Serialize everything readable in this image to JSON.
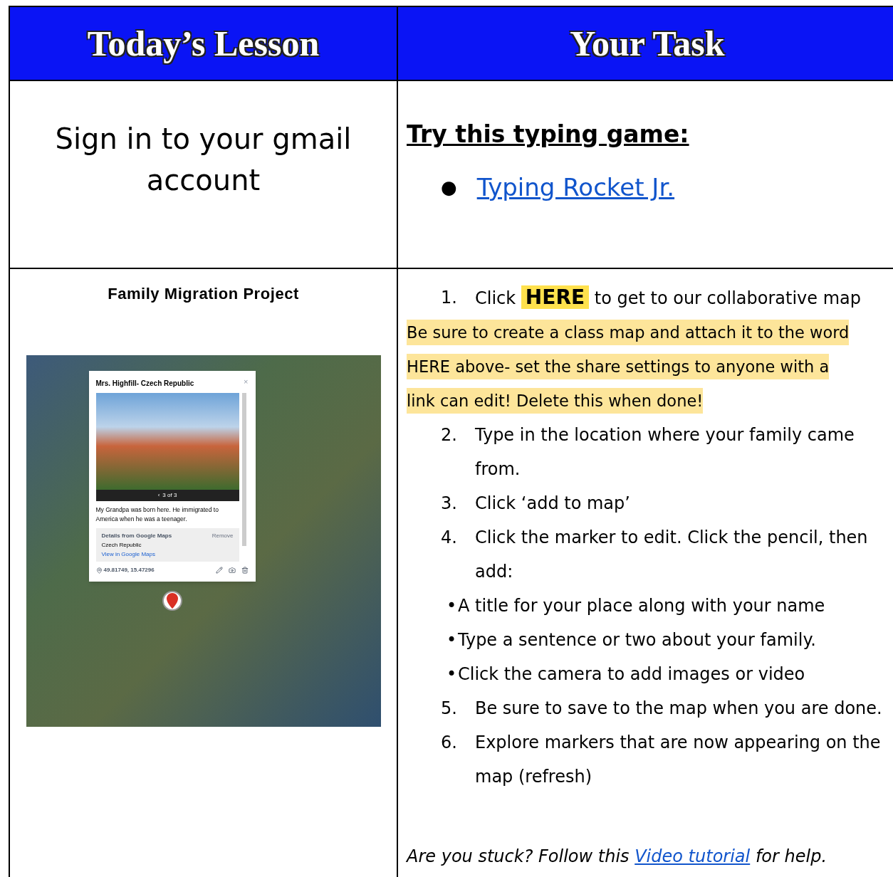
{
  "header": {
    "left": "Today’s Lesson",
    "right": "Your Task"
  },
  "lesson": {
    "text": "Sign in to your gmail account"
  },
  "task": {
    "heading": "Try this typing game:",
    "bullet": "●",
    "link": "Typing Rocket Jr."
  },
  "project": {
    "title": "Family Migration Project",
    "map_popup": {
      "title": "Mrs. Highfill- Czech Republic",
      "close": "×",
      "photo_counter": "3 of 3",
      "photo_prev": "‹",
      "description": "My Grandpa was born here. He immigrated to America when he was a teenager.",
      "details_title": "Details from Google Maps",
      "remove": "Remove",
      "place": "Czech Republic",
      "maps_link": "View in Google Maps",
      "coordinates": "49.81749, 15.47296"
    }
  },
  "steps": [
    {
      "kind": "numbered",
      "number": "1.",
      "text": "Click",
      "link": "HERE",
      "after": "to get to our collaborative map"
    },
    {
      "kind": "note",
      "lines": [
        "Be sure to create a class map and attach it to the word",
        "HERE above- set the share settings to anyone with a",
        "link can edit! Delete this when done!"
      ]
    },
    {
      "kind": "numbered",
      "number": "2.",
      "text": "Type in the location where your family came from."
    },
    {
      "kind": "numbered",
      "number": "3.",
      "text": "Click ‘add to map’"
    },
    {
      "kind": "numbered",
      "number": "4.",
      "text": "Click the marker to edit. Click the pencil, then add:"
    },
    {
      "kind": "bullet",
      "bullet": "•",
      "text": "A title for your place along with your name"
    },
    {
      "kind": "bullet",
      "bullet": "•",
      "text": "Type a sentence or two about your family."
    },
    {
      "kind": "bullet",
      "bullet": "•",
      "text": "Click the camera to add images or video"
    },
    {
      "kind": "numbered",
      "number": "5.",
      "text": "Be sure to save to the map when you are done."
    },
    {
      "kind": "numbered",
      "number": "6.",
      "text": "Explore markers that are now appearing on the map (refresh)"
    }
  ],
  "help": {
    "before": "Are you stuck? Follow this",
    "link": "Video tutorial",
    "after": "for help."
  }
}
